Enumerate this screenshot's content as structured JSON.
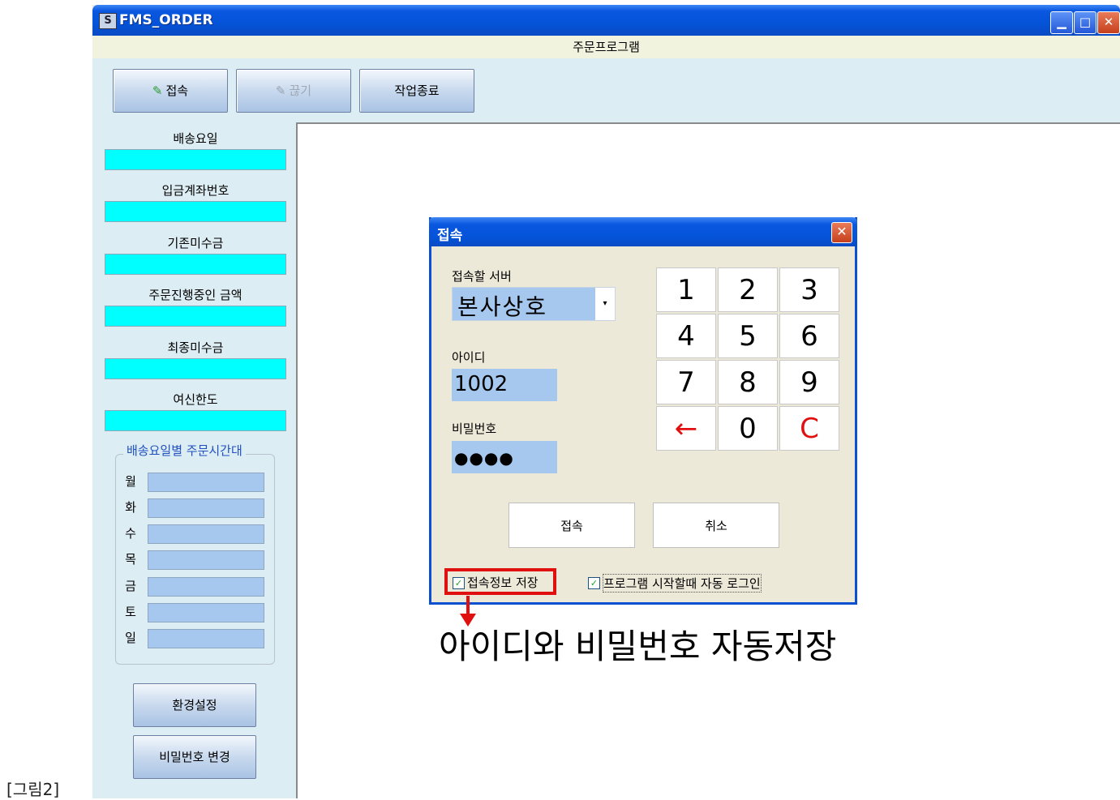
{
  "figure_caption": "[그림2]",
  "window": {
    "title": "FMS_ORDER",
    "app_icon": "S",
    "min_icon": "▁",
    "max_icon": "□",
    "close_icon": "✕",
    "subtitle": "주문프로그램"
  },
  "toolbar": {
    "connect_label": "접속",
    "disconnect_label": "끊기",
    "exit_label": "작업종료",
    "plug_icon": "✎"
  },
  "sidebar": {
    "labels": [
      "배송요일",
      "입금계좌번호",
      "기존미수금",
      "주문진행중인 금액",
      "최종미수금",
      "여신한도"
    ],
    "group_title": "배송요일별 주문시간대",
    "days": [
      "월",
      "화",
      "수",
      "목",
      "금",
      "토",
      "일"
    ],
    "settings_button": "환경설정",
    "password_button": "비밀번호 변경"
  },
  "dialog": {
    "title": "접속",
    "close_icon": "✕",
    "server_label": "접속할 서버",
    "server_value": "본사상호",
    "dropdown_icon": "▾",
    "id_label": "아이디",
    "id_value": "1002",
    "password_label": "비밀번호",
    "password_value": "●●●●",
    "keypad": [
      "1",
      "2",
      "3",
      "4",
      "5",
      "6",
      "7",
      "8",
      "9",
      "←",
      "0",
      "C"
    ],
    "connect_button": "접속",
    "cancel_button": "취소",
    "save_info_label": "접속정보 저장",
    "auto_login_label": "프로그램 시작할때 자동 로그인",
    "check_mark": "✓"
  },
  "annotation": {
    "text": "아이디와 비밀번호 자동저장",
    "highlight_color": "#e01010"
  }
}
